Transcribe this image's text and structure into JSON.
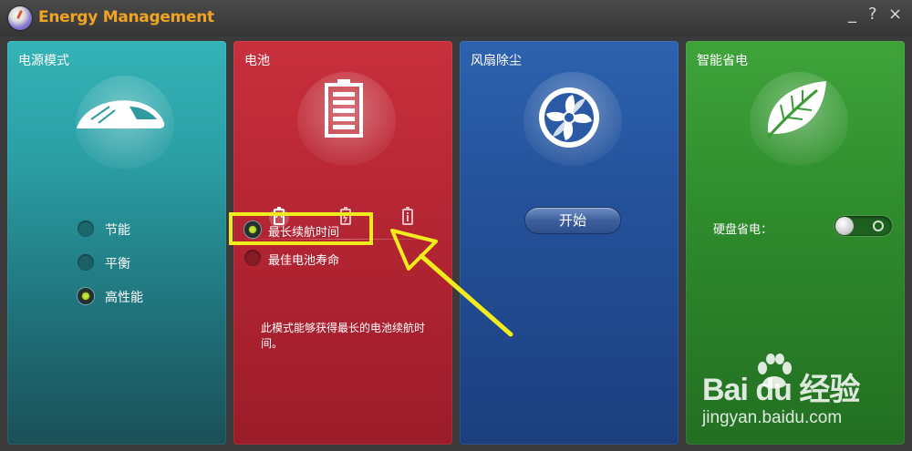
{
  "app": {
    "title": "Energy Management"
  },
  "window_controls": {
    "minimize": "_",
    "help": "?",
    "close": "×"
  },
  "panels": {
    "power_mode": {
      "title": "电源模式",
      "options": [
        {
          "label": "节能",
          "selected": false
        },
        {
          "label": "平衡",
          "selected": false
        },
        {
          "label": "高性能",
          "selected": true
        }
      ]
    },
    "battery": {
      "title": "电池",
      "options": [
        {
          "label": "最长续航时间",
          "selected": true
        },
        {
          "label": "最佳电池寿命",
          "selected": false
        }
      ],
      "description": "此模式能够获得最长的电池续航时间。"
    },
    "fan": {
      "title": "风扇除尘",
      "start_label": "开始"
    },
    "smart_save": {
      "title": "智能省电",
      "hdd_label": "硬盘省电：",
      "hdd_enabled": false
    }
  },
  "watermark": {
    "brand": "Bai du 经验",
    "url": "jingyan.baidu.com"
  },
  "colors": {
    "title_accent": "#f0a422",
    "highlight": "#f2ec1d"
  }
}
